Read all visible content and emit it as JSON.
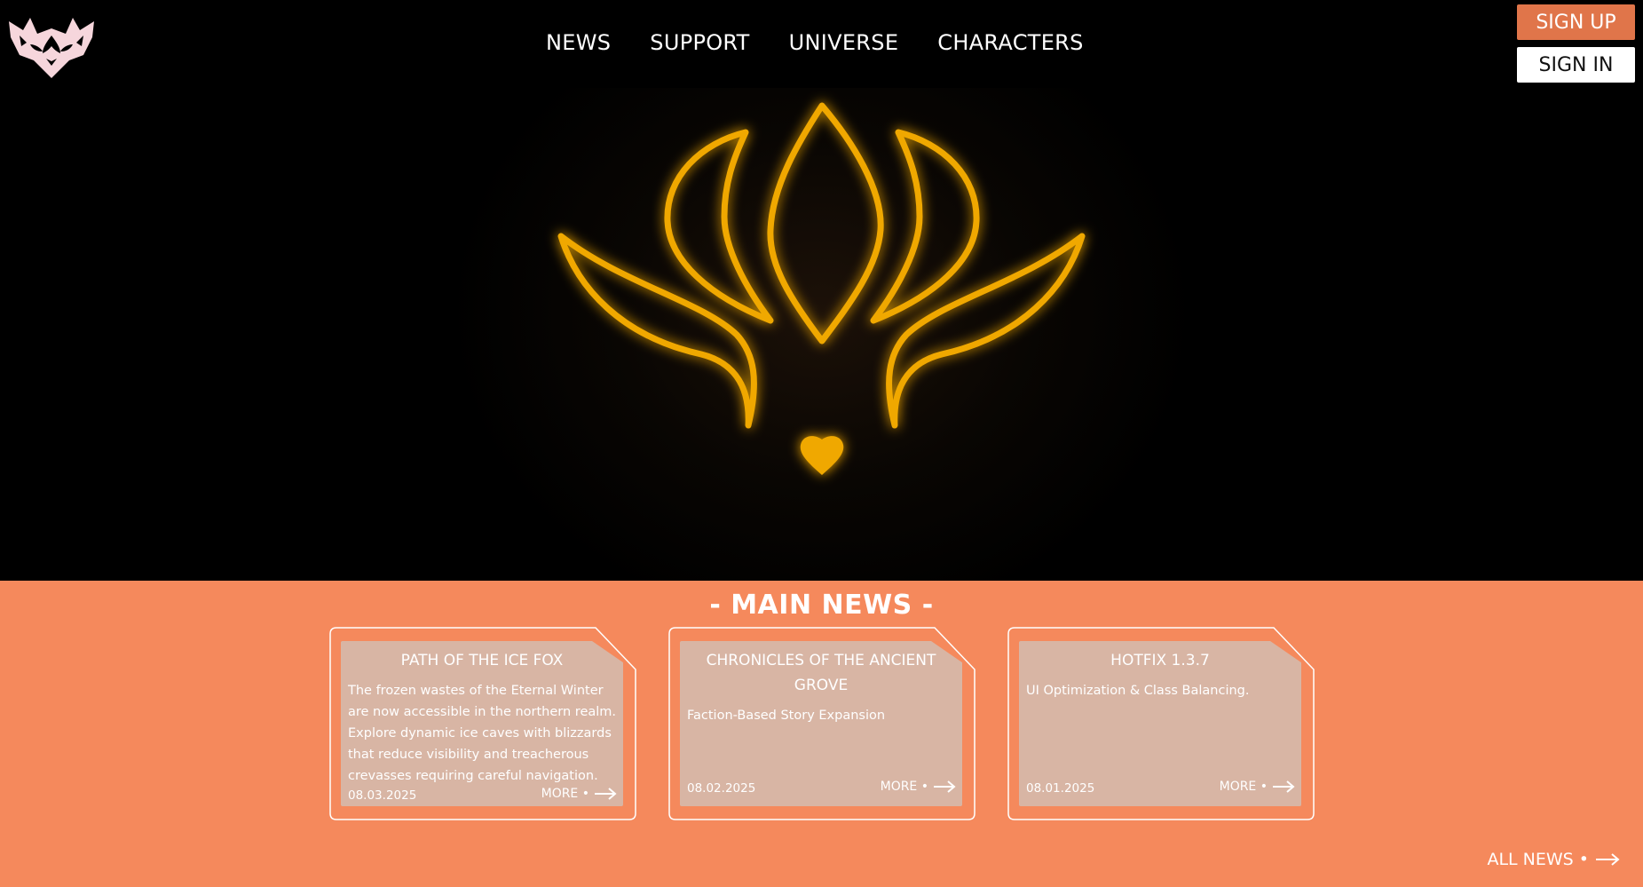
{
  "header": {
    "nav": [
      "NEWS",
      "SUPPORT",
      "UNIVERSE",
      "CHARACTERS"
    ],
    "signup_label": "SIGN UP",
    "signin_label": "SIGN IN"
  },
  "news": {
    "title": "- MAIN NEWS -",
    "cards": [
      {
        "title": "PATH OF THE ICE FOX",
        "text": "The frozen wastes of the Eternal Winter are now accessible in the northern realm. Explore dynamic ice caves with blizzards that reduce visibility and treacherous crevasses requiring careful navigation.",
        "date": "08.03.2025",
        "more": "MORE •"
      },
      {
        "title": "CHRONICLES OF THE ANCIENT GROVE",
        "text": "Faction-Based Story Expansion",
        "date": "08.02.2025",
        "more": "MORE •"
      },
      {
        "title": "HOTFIX 1.3.7",
        "text": "UI Optimization & Class Balancing.",
        "date": "08.01.2025",
        "more": "MORE •"
      }
    ],
    "all_news": "ALL NEWS •"
  },
  "colors": {
    "accent": "#e0754a",
    "section_bg": "#f5895c",
    "card_bg": "#d8b5a4",
    "emblem": "#f0a800"
  },
  "icons": [
    "fox-logo-icon",
    "emblem-icon",
    "heart-icon",
    "arrow-right-icon"
  ]
}
